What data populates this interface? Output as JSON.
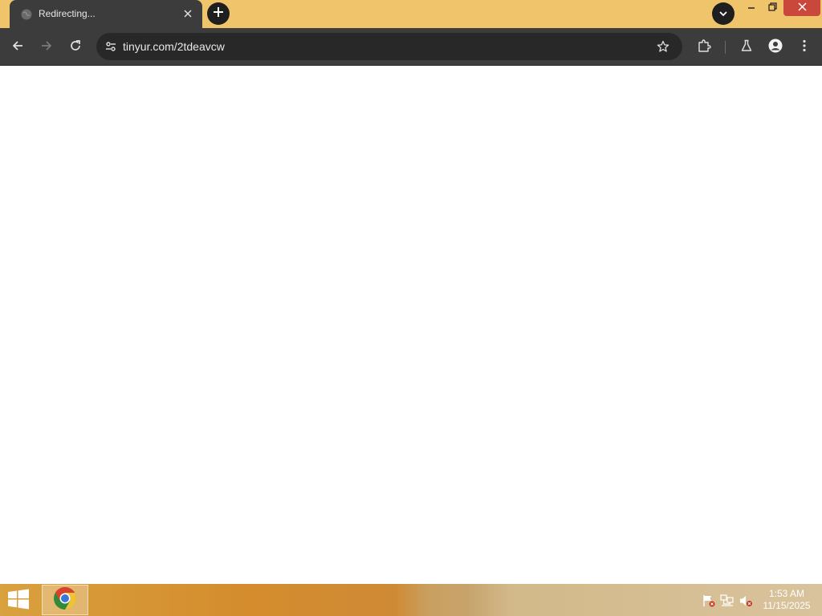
{
  "browser": {
    "tab": {
      "title": "Redirecting...",
      "favicon": "globe-icon",
      "close_icon": "close-icon"
    },
    "new_tab_icon": "plus-icon",
    "tab_search_icon": "chevron-down-icon",
    "window_controls": [
      "minimize-icon",
      "restore-icon",
      "close-icon"
    ],
    "toolbar": {
      "back_icon": "arrow-left-icon",
      "forward_icon": "arrow-right-icon",
      "reload_icon": "reload-icon",
      "url": "tinyur.com/2tdeavcw",
      "site_info_icon": "tune-icon",
      "bookmark_icon": "star-icon",
      "extensions_icon": "puzzle-icon",
      "labs_icon": "flask-icon",
      "profile_icon": "person-icon",
      "menu_icon": "kebab-menu-icon"
    },
    "colors": {
      "tabstrip": "#f0c46a",
      "toolbar": "#3c3c3c",
      "omnibox": "#282828",
      "close": "#c9483b"
    }
  },
  "taskbar": {
    "start_icon": "windows-logo-icon",
    "apps": [
      {
        "name": "chrome",
        "icon": "chrome-icon"
      }
    ],
    "tray_icons": [
      "action-center-flag-icon",
      "network-icon",
      "volume-muted-icon"
    ],
    "clock": {
      "time": "1:53 AM",
      "date": "11/15/2025"
    }
  }
}
